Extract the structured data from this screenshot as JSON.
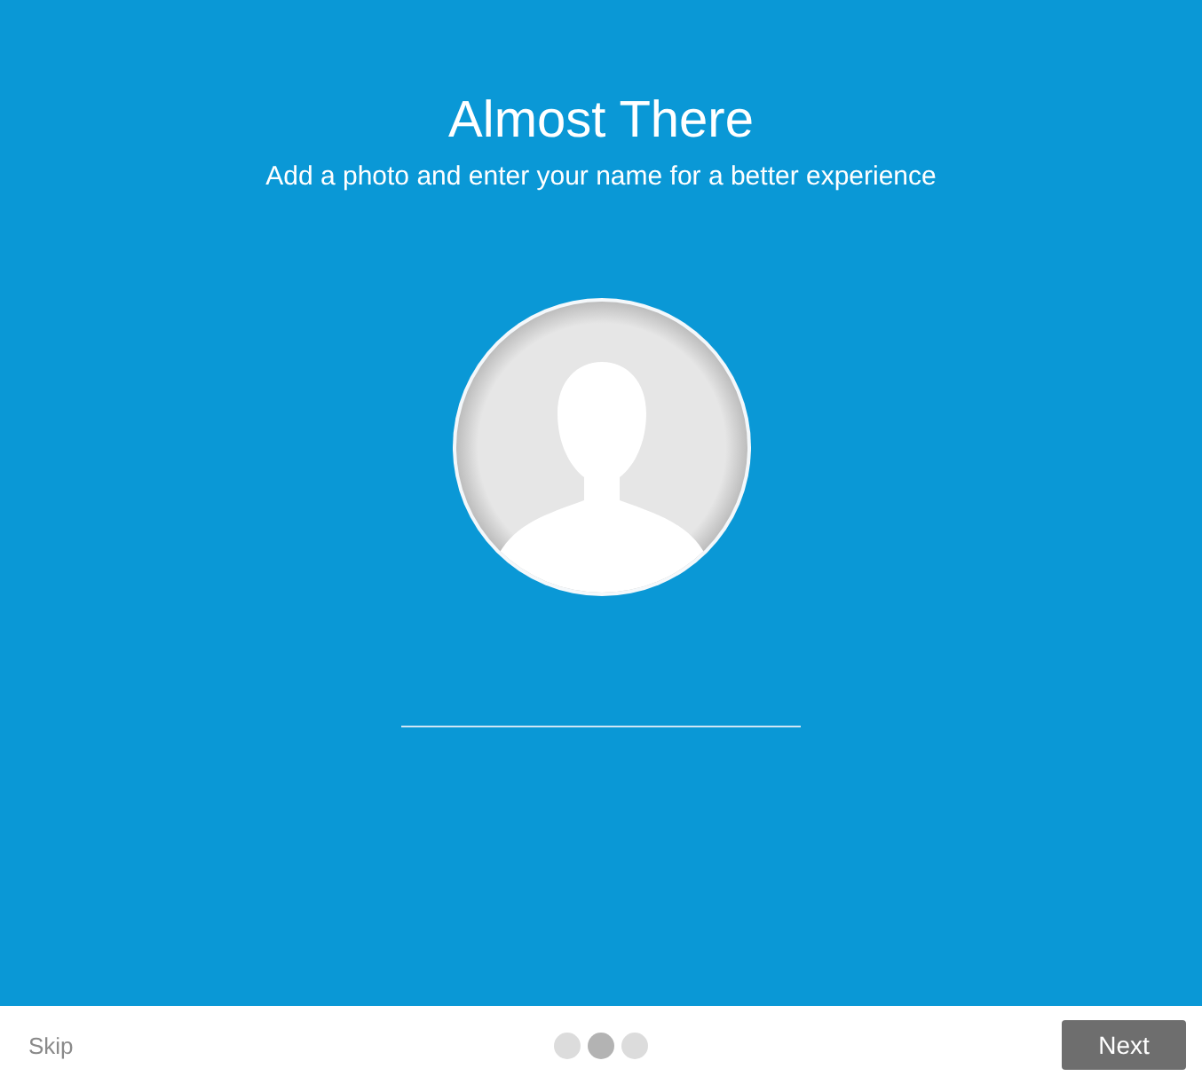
{
  "title": "Almost There",
  "subtitle": "Add a photo and enter your name for a better experience",
  "footer": {
    "skip": "Skip",
    "page_dots": [
      {
        "selected": false
      },
      {
        "selected": true
      },
      {
        "selected": false
      }
    ],
    "next": "Next"
  }
}
